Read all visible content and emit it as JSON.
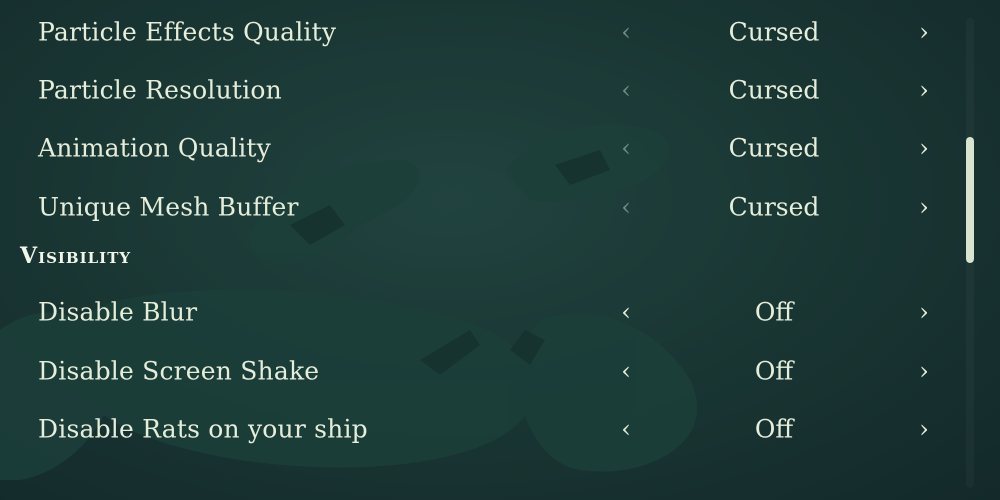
{
  "graphics_rows": [
    {
      "label": "Particle Effects Quality",
      "value": "Cursed",
      "left_arrow": "‹",
      "right_arrow": "›"
    },
    {
      "label": "Particle Resolution",
      "value": "Cursed",
      "left_arrow": "‹",
      "right_arrow": "›"
    },
    {
      "label": "Animation Quality",
      "value": "Cursed",
      "left_arrow": "‹",
      "right_arrow": "›"
    },
    {
      "label": "Unique Mesh Buffer",
      "value": "Cursed",
      "left_arrow": "‹",
      "right_arrow": "›"
    }
  ],
  "visibility": {
    "header": "Visibility",
    "rows": [
      {
        "label": "Disable Blur",
        "value": "Off",
        "left_arrow": "‹",
        "right_arrow": "›"
      },
      {
        "label": "Disable Screen Shake",
        "value": "Off",
        "left_arrow": "‹",
        "right_arrow": "›"
      },
      {
        "label": "Disable Rats on your ship",
        "value": "Off",
        "left_arrow": "‹",
        "right_arrow": "›"
      }
    ]
  },
  "icons": {
    "left_arrow": "chevron-left-icon",
    "right_arrow": "chevron-right-icon",
    "background": "reaper-emblem-background"
  },
  "colors": {
    "background": "#1a3734",
    "text": "#e6eedb",
    "dim_arrow": "#6f8d85",
    "scroll_thumb": "#d9e3cf"
  }
}
